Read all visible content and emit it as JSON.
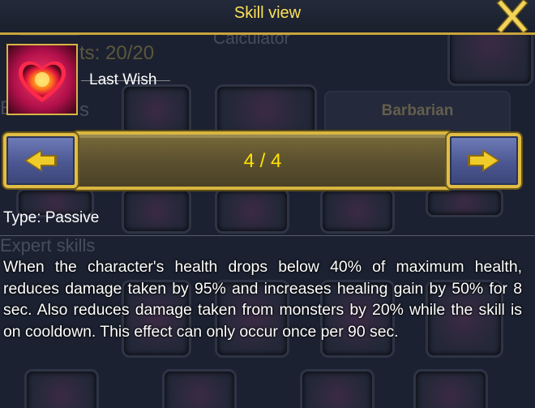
{
  "background": {
    "points_text": "ts: 20/20",
    "calculator_text": "Calculator",
    "class_tab": "Barbarian",
    "skills_fragment": "s",
    "b_fragment": "B",
    "expert_skills": "Expert skills"
  },
  "title_bar": {
    "title": "Skill view",
    "close_icon": "close-x-icon"
  },
  "skill": {
    "name": "Last Wish",
    "icon": "glowing-heart-icon",
    "type_label": "Type: Passive",
    "description": "When the character's health drops below 40% of maximum health, reduces damage taken by 95% and increases healing gain by 50% for 8 sec. Also reduces damage taken from monsters by 20% while the skill is on cooldown. This effect can only occur once per 90 sec."
  },
  "pager": {
    "current": "4 / 4",
    "prev_icon": "left-arrow-icon",
    "next_icon": "right-arrow-icon"
  },
  "colors": {
    "gold": "#d8b640",
    "title_yellow": "#ffe05a",
    "page_yellow": "#ffe200",
    "button_blue": "#4b5791"
  }
}
